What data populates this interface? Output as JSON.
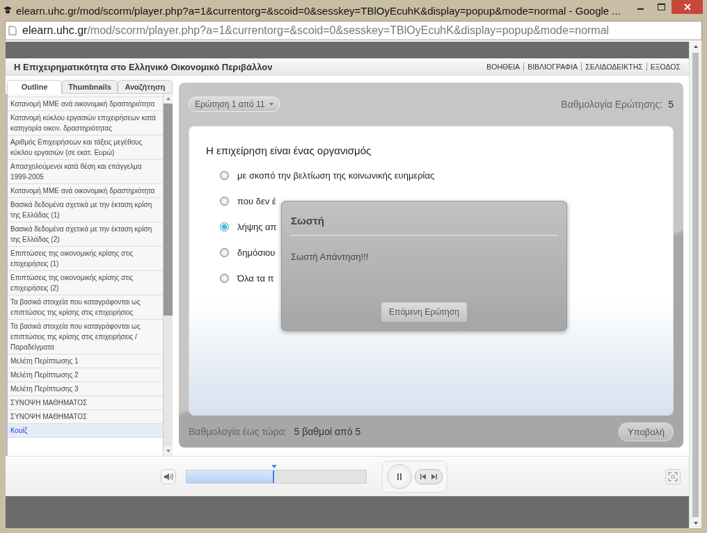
{
  "browser": {
    "title": "elearn.uhc.gr/mod/scorm/player.php?a=1&currentorg=&scoid=0&sesskey=TBlOyEcuhK&display=popup&mode=normal - Google ...",
    "url_host": "elearn.uhc.gr",
    "url_path": "/mod/scorm/player.php?a=1&currentorg=&scoid=0&sesskey=TBlOyEcuhK&display=popup&mode=normal"
  },
  "course": {
    "title": "Η Επιχειρηματικότητα στο Ελληνικό Οικονομικό Περιβάλλον",
    "links": [
      "ΒΟΗΘΕΙΑ",
      "ΒΙΒΛΙΟΓΡΑΦΙΑ",
      "ΣΕΛΙΔΟΔΕΙΚΤΗΣ",
      "ΕΞΟΔΟΣ"
    ]
  },
  "tabs": [
    {
      "label": "Outline",
      "selected": true
    },
    {
      "label": "Thumbnails",
      "selected": false
    },
    {
      "label": "Αναζήτηση",
      "selected": false
    }
  ],
  "outline": [
    {
      "label": "Κατανομή ΜΜΕ ανά οικονομική δραστηριότητα",
      "selected": false
    },
    {
      "label": "Κατανομή κύκλου εργασιών επιχειρήσεων κατά κατηγορία οικον. δραστηριότητας",
      "selected": false
    },
    {
      "label": "Αριθμός Επιχειρήσεων και τάξεις μεγέθους κύκλου εργασιών (σε εκατ. Ευρώ)",
      "selected": false
    },
    {
      "label": "Απασχολούμενοι κατά θέση και επάγγελμα 1999-2005",
      "selected": false
    },
    {
      "label": "Κατανομή ΜΜΕ ανά οικονομική δραστηριότητα",
      "selected": false
    },
    {
      "label": "Βασικά δεδομένα σχετικά με την έκταση κρίση της Ελλάδας (1)",
      "selected": false
    },
    {
      "label": "Βασικά δεδομένα σχετικά με την έκταση κρίση της Ελλάδας (2)",
      "selected": false
    },
    {
      "label": "Επιπτώσεις της οικονομικής κρίσης στις επιχειρήσεις (1)",
      "selected": false
    },
    {
      "label": "Επιπτώσεις της οικονομικής κρίσης στις επιχειρήσεις (2)",
      "selected": false
    },
    {
      "label": "Τα βασικά στοιχεία που καταγράφονται ως επιπτώσεις της κρίσης στις επιχειρήσεις",
      "selected": false
    },
    {
      "label": "Τα βασικά στοιχεία που καταγράφονται ως επιπτώσεις της κρίσης στις επιχειρήσεις /Παραδείγματα",
      "selected": false
    },
    {
      "label": "Μελέτη Περίπτωσης 1",
      "selected": false
    },
    {
      "label": "Μελέτη Περίπτωσης 2",
      "selected": false
    },
    {
      "label": "Μελέτη Περίπτωσης 3",
      "selected": false
    },
    {
      "label": "ΣΥΝΟΨΗ ΜΑΘΗΜΑΤΟΣ",
      "selected": false
    },
    {
      "label": "ΣΥΝΟΨΗ ΜΑΘΗΜΑΤΟΣ",
      "selected": false
    },
    {
      "label": "Κουίζ",
      "selected": true
    }
  ],
  "quiz": {
    "question_picker": "Ερώτηση 1 από 11",
    "score_label": "Βαθμολογία Ερώτησης:",
    "score": "5",
    "question": "Η επιχείρηση είναι ένας οργανισμός",
    "options": [
      {
        "text": "με σκοπό την βελτίωση της κοινωνικής ευημερίας",
        "selected": false
      },
      {
        "text": "που δεν έ",
        "selected": false
      },
      {
        "text": "λήψης απ",
        "selected": true
      },
      {
        "text": "δημόσιου",
        "selected": false
      },
      {
        "text": "Όλα τα π",
        "selected": false
      }
    ],
    "total_label": "Βαθμολογία έως τώρα:",
    "total": "5 βαθμοί από 5",
    "submit": "Υποβολή"
  },
  "dialog": {
    "title": "Σωστή",
    "message": "Σωστή Απάντηση!!!",
    "button": "Επόμενη Ερώτηση"
  },
  "player": {
    "level": 0.49
  }
}
